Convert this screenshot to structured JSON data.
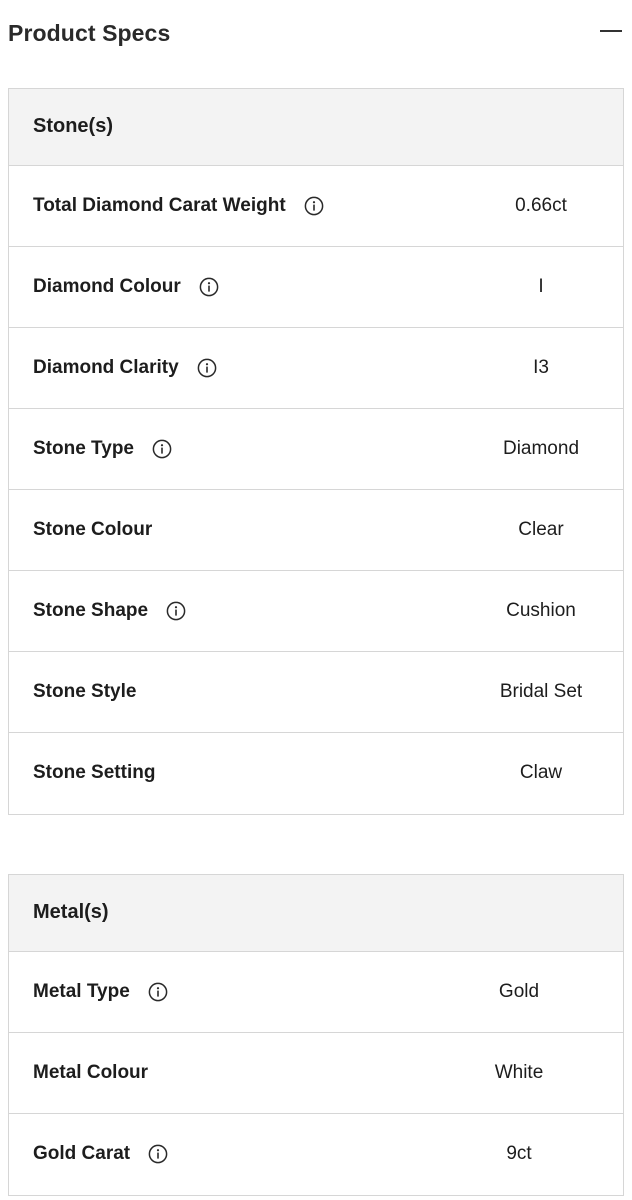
{
  "header": {
    "title": "Product Specs",
    "collapse_icon": "minus-icon"
  },
  "stones": {
    "heading": "Stone(s)",
    "rows": [
      {
        "label": "Total Diamond Carat Weight",
        "value": "0.66ct",
        "has_info": true
      },
      {
        "label": "Diamond Colour",
        "value": "I",
        "has_info": true
      },
      {
        "label": "Diamond Clarity",
        "value": "I3",
        "has_info": true
      },
      {
        "label": "Stone Type",
        "value": "Diamond",
        "has_info": true
      },
      {
        "label": "Stone Colour",
        "value": "Clear",
        "has_info": false
      },
      {
        "label": "Stone Shape",
        "value": "Cushion",
        "has_info": true
      },
      {
        "label": "Stone Style",
        "value": "Bridal Set",
        "has_info": false
      },
      {
        "label": "Stone Setting",
        "value": "Claw",
        "has_info": false
      }
    ]
  },
  "metals": {
    "heading": "Metal(s)",
    "rows": [
      {
        "label": "Metal Type",
        "value": "Gold",
        "has_info": true
      },
      {
        "label": "Metal Colour",
        "value": "White",
        "has_info": false
      },
      {
        "label": "Gold Carat",
        "value": "9ct",
        "has_info": true
      }
    ]
  },
  "colors": {
    "border": "#d6d6d6",
    "header_bg": "#f3f3f3",
    "text": "#1d1d1d"
  }
}
